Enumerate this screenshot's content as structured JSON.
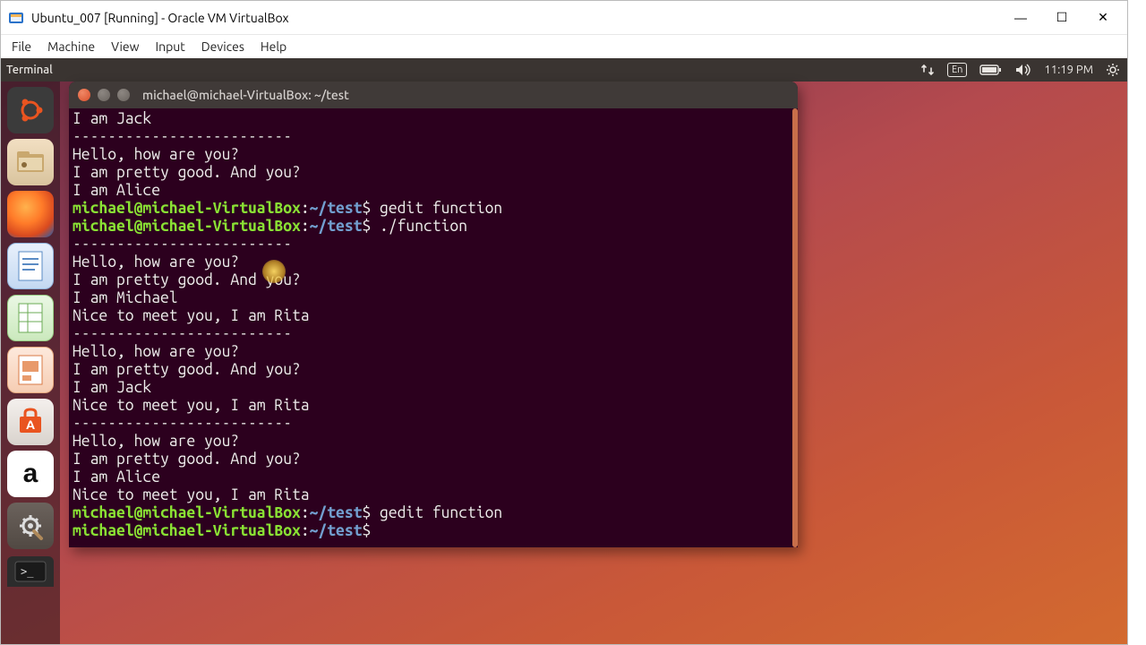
{
  "vbox": {
    "title": "Ubuntu_007 [Running] - Oracle VM VirtualBox",
    "menu": [
      "File",
      "Machine",
      "View",
      "Input",
      "Devices",
      "Help"
    ],
    "controls": {
      "min": "—",
      "max": "☐",
      "close": "✕"
    }
  },
  "ubuntu": {
    "panel_app": "Terminal",
    "tray": {
      "lang": "En",
      "time": "11:19 PM"
    }
  },
  "launcher": {
    "items": [
      {
        "name": "ubuntu-dash",
        "label": ""
      },
      {
        "name": "files",
        "label": ""
      },
      {
        "name": "firefox",
        "label": ""
      },
      {
        "name": "libreoffice-writer",
        "label": ""
      },
      {
        "name": "libreoffice-calc",
        "label": ""
      },
      {
        "name": "libreoffice-impress",
        "label": ""
      },
      {
        "name": "ubuntu-software",
        "label": "A"
      },
      {
        "name": "amazon",
        "label": "a"
      },
      {
        "name": "system-settings",
        "label": ""
      },
      {
        "name": "terminal",
        "label": ">_"
      }
    ]
  },
  "terminal": {
    "title": "michael@michael-VirtualBox: ~/test",
    "prompt_user": "michael@michael-VirtualBox",
    "prompt_path": "~/test",
    "lines": [
      {
        "t": "out",
        "text": "I am Jack"
      },
      {
        "t": "out",
        "text": "-------------------------"
      },
      {
        "t": "out",
        "text": "Hello, how are you?"
      },
      {
        "t": "out",
        "text": "I am pretty good. And you?"
      },
      {
        "t": "out",
        "text": "I am Alice"
      },
      {
        "t": "prompt",
        "cmd": "gedit function"
      },
      {
        "t": "prompt",
        "cmd": "./function"
      },
      {
        "t": "out",
        "text": "-------------------------"
      },
      {
        "t": "out",
        "text": "Hello, how are you?"
      },
      {
        "t": "out",
        "text": "I am pretty good. And you?"
      },
      {
        "t": "out",
        "text": "I am Michael"
      },
      {
        "t": "out",
        "text": "Nice to meet you, I am Rita"
      },
      {
        "t": "out",
        "text": "-------------------------"
      },
      {
        "t": "out",
        "text": "Hello, how are you?"
      },
      {
        "t": "out",
        "text": "I am pretty good. And you?"
      },
      {
        "t": "out",
        "text": "I am Jack"
      },
      {
        "t": "out",
        "text": "Nice to meet you, I am Rita"
      },
      {
        "t": "out",
        "text": "-------------------------"
      },
      {
        "t": "out",
        "text": "Hello, how are you?"
      },
      {
        "t": "out",
        "text": "I am pretty good. And you?"
      },
      {
        "t": "out",
        "text": "I am Alice"
      },
      {
        "t": "out",
        "text": "Nice to meet you, I am Rita"
      },
      {
        "t": "prompt",
        "cmd": "gedit function"
      },
      {
        "t": "prompt",
        "cmd": ""
      }
    ]
  }
}
